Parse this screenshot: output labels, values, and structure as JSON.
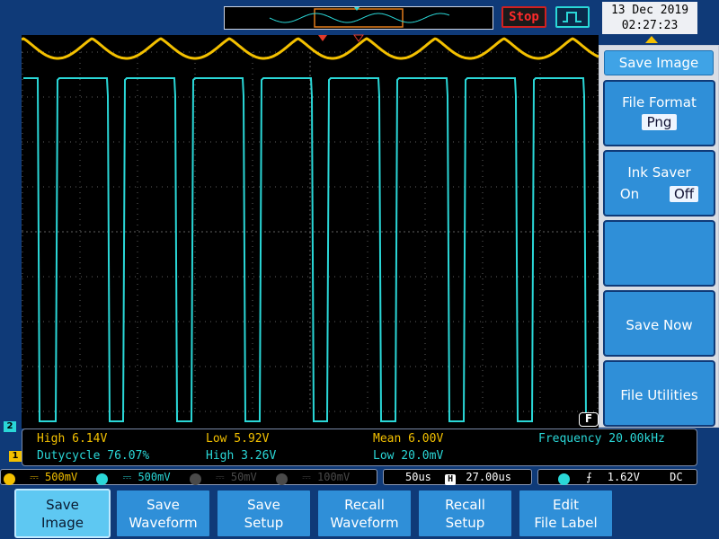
{
  "header": {
    "run_state": "Stop",
    "date": "13 Dec 2019",
    "time": "02:27:23"
  },
  "side_menu": {
    "title": "Save Image",
    "file_format_label": "File Format",
    "file_format_value": "Png",
    "ink_saver_label": "Ink Saver",
    "ink_saver_on": "On",
    "ink_saver_off": "Off",
    "ink_saver_selected": "Off",
    "save_now": "Save Now",
    "file_utilities": "File Utilities"
  },
  "screen": {
    "filter_badge": "F",
    "ch1_marker": "1",
    "ch2_marker": "2"
  },
  "measurements": {
    "ch1_high_ch": "1",
    "ch1_high": "High 6.14V",
    "ch1_low_ch": "1",
    "ch1_low": "Low 5.92V",
    "ch1_mean_ch": "1",
    "ch1_mean": "Mean 6.00V",
    "ch2_freq_ch": "2",
    "ch2_freq": "Frequency 20.00kHz",
    "ch2_duty_ch": "2",
    "ch2_duty": "Dutycycle 76.07%",
    "ch2_high_ch": "2",
    "ch2_high": "High 3.26V",
    "ch2_low_ch": "2",
    "ch2_low": "Low 20.0mV"
  },
  "status": {
    "ch1_num": "1",
    "ch1_coupling": "⎓",
    "ch1_scale": "500mV",
    "ch2_num": "2",
    "ch2_coupling": "⎓",
    "ch2_scale": "500mV",
    "ch3_num": "3",
    "ch3_coupling": "⎓",
    "ch3_scale": "50mV",
    "ch4_num": "4",
    "ch4_coupling": "⎓",
    "ch4_scale": "100mV",
    "timebase": "50us",
    "h_icon": "H",
    "h_position": "27.00us",
    "trig_source": "2",
    "trig_slope": "⨍",
    "trig_level": "1.62V",
    "trig_coupling": "DC"
  },
  "softkeys": [
    {
      "line1": "Save",
      "line2": "Image"
    },
    {
      "line1": "Save",
      "line2": "Waveform"
    },
    {
      "line1": "Save",
      "line2": "Setup"
    },
    {
      "line1": "Recall",
      "line2": "Waveform"
    },
    {
      "line1": "Recall",
      "line2": "Setup"
    },
    {
      "line1": "Edit",
      "line2": "File Label"
    }
  ],
  "colors": {
    "ch1": "#f3c000",
    "ch2": "#2ad7d7",
    "bezel": "#0f3a78",
    "button": "#2f8fd8",
    "button_active": "#5ec8f2"
  }
}
